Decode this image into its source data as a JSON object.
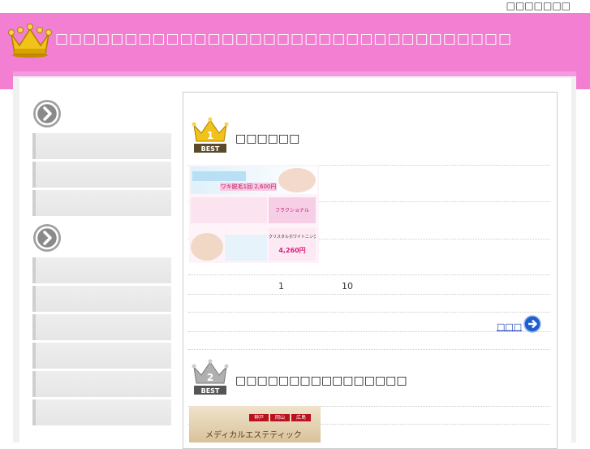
{
  "topbar": {
    "tagline": "□□□□□□□"
  },
  "header": {
    "site_title": "□□□□□□□□□□□□□□□□□□□□□□□□□□□□□□□□□"
  },
  "sidebar": {
    "section1_items": [
      "",
      "",
      ""
    ],
    "section2_items": [
      "",
      "",
      "",
      "",
      "",
      ""
    ]
  },
  "ranking": [
    {
      "rank_label": "1",
      "best_label": "BEST",
      "shop_name": "□□□□□□",
      "banner_texts": [
        "ワキ脱毛1回 2,600円",
        "フラクショナル",
        "クリスタルホワイトニング",
        "4,260円"
      ],
      "info_values": [
        "1",
        "10"
      ],
      "more_label": "□□□"
    },
    {
      "rank_label": "2",
      "best_label": "BEST",
      "shop_name": "□□□□□□□□□□□□□□□□",
      "banner_texts": [
        "神戸",
        "岡山",
        "広島",
        "メディカルエステティック"
      ]
    }
  ],
  "colors": {
    "header_pink": "#f37fd2",
    "header_band": "#f39ae0",
    "gold": "#e8b400",
    "silver": "#9a9a9a"
  }
}
